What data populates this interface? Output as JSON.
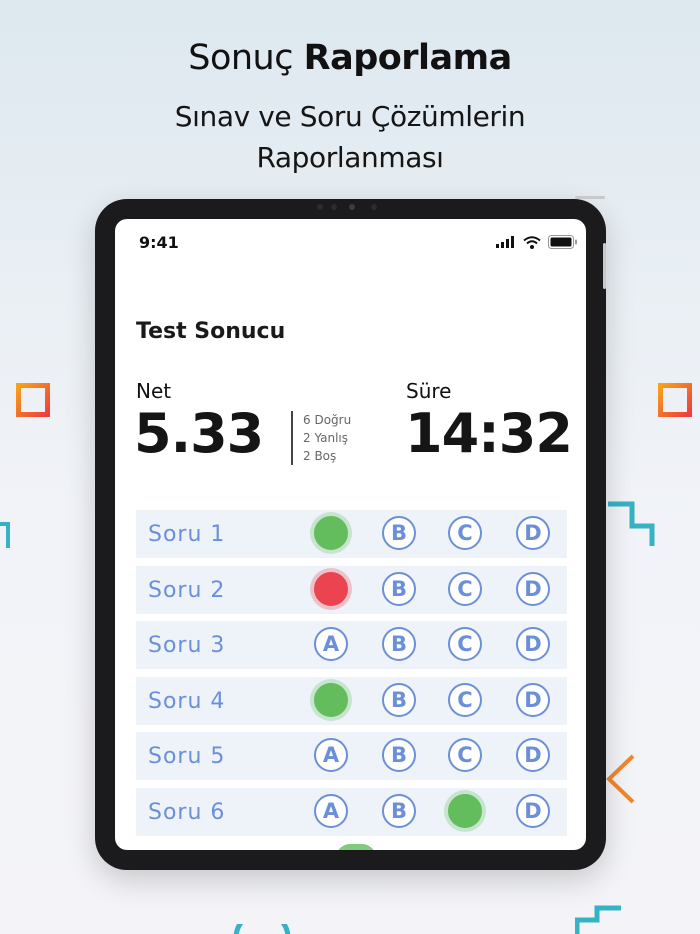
{
  "header": {
    "title_regular": "Sonuç",
    "title_bold": "Raporlama",
    "subtitle_line1": "Sınav ve Soru Çözümlerin",
    "subtitle_line2": "Raporlanması"
  },
  "status_bar": {
    "time": "9:41"
  },
  "result": {
    "title": "Test Sonucu",
    "net_label": "Net",
    "net_value": "5.33",
    "correct": "6 Doğru",
    "wrong": "2 Yanlış",
    "blank": "2 Boş",
    "time_label": "Süre",
    "time_value": "14:32"
  },
  "questions": [
    {
      "label": "Soru  1",
      "options": [
        "A",
        "B",
        "C",
        "D"
      ],
      "selected": "A",
      "status": "correct"
    },
    {
      "label": "Soru  2",
      "options": [
        "A",
        "B",
        "C",
        "D"
      ],
      "selected": "A",
      "status": "wrong"
    },
    {
      "label": "Soru  3",
      "options": [
        "A",
        "B",
        "C",
        "D"
      ],
      "selected": null,
      "status": "blank"
    },
    {
      "label": "Soru  4",
      "options": [
        "A",
        "B",
        "C",
        "D"
      ],
      "selected": "A",
      "status": "correct"
    },
    {
      "label": "Soru  5",
      "options": [
        "A",
        "B",
        "C",
        "D"
      ],
      "selected": null,
      "status": "blank"
    },
    {
      "label": "Soru  6",
      "options": [
        "A",
        "B",
        "C",
        "D"
      ],
      "selected": "C",
      "status": "correct"
    }
  ],
  "colors": {
    "accent": "#6b8fd8",
    "correct": "#63bd5c",
    "wrong": "#eb4450",
    "row_bg": "#eef3fa",
    "deco_orange": "#f26b2a",
    "deco_teal": "#35b3c4"
  }
}
